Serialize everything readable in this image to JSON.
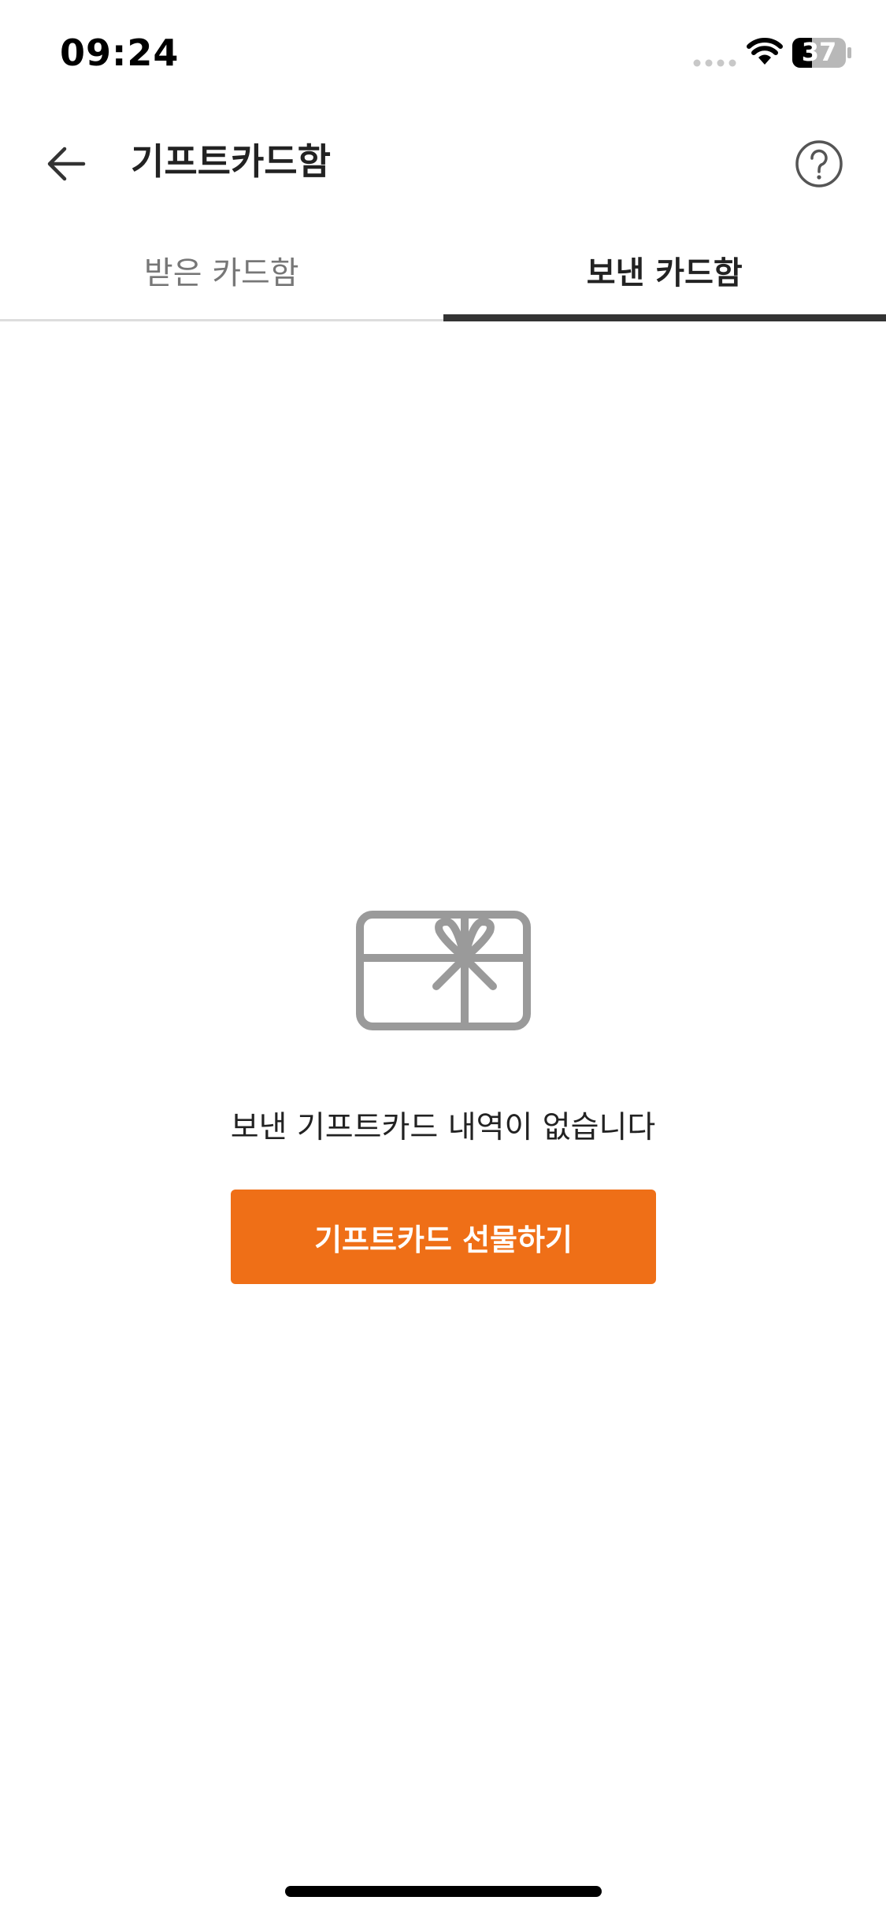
{
  "status_bar": {
    "time": "09:24",
    "battery_level": "37",
    "signal_icon": "signal-icon",
    "wifi_icon": "wifi-icon",
    "battery_icon": "battery-icon"
  },
  "header": {
    "title": "기프트카드함",
    "back_icon": "arrow-left-icon",
    "help_icon": "question-circle-icon"
  },
  "tabs": [
    {
      "label": "받은 카드함",
      "active": false
    },
    {
      "label": "보낸 카드함",
      "active": true
    }
  ],
  "empty_state": {
    "icon": "gift-card-icon",
    "message": "보낸 기프트카드 내역이 없습니다",
    "button_label": "기프트카드 선물하기"
  },
  "colors": {
    "accent": "#ef6f17",
    "text": "#222222",
    "tab_inactive": "#777777",
    "tab_indicator": "#333333",
    "icon_gray": "#9a9a9a"
  }
}
